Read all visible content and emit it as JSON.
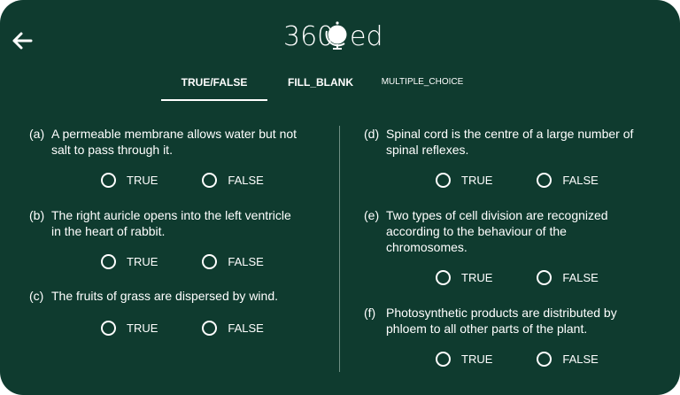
{
  "header": {
    "back_icon": "arrow-left-icon",
    "logo_text_left": "360",
    "logo_text_right": "ed"
  },
  "tabs": [
    {
      "label": "TRUE/FALSE",
      "active": true
    },
    {
      "label": "FILL_BLANK",
      "active": false
    },
    {
      "label": "MULTIPLE_CHOICE",
      "active": false
    }
  ],
  "questions": [
    {
      "letter": "(a)",
      "text_line1": "A permeable membrane allows water but not",
      "text_line2": "salt to pass through it.",
      "text_line3": "",
      "true_label": "TRUE",
      "false_label": "FALSE"
    },
    {
      "letter": "(b)",
      "text_line1": "The right auricle opens into the left ventricle",
      "text_line2": "in the heart of rabbit.",
      "text_line3": "",
      "true_label": "TRUE",
      "false_label": "FALSE"
    },
    {
      "letter": "(c)",
      "text_line1": "The fruits of grass are dispersed by wind.",
      "text_line2": "",
      "text_line3": "",
      "true_label": "TRUE",
      "false_label": "FALSE"
    },
    {
      "letter": "(d)",
      "text_line1": "Spinal cord is the centre of a large number of",
      "text_line2": "spinal reflexes.",
      "text_line3": "",
      "true_label": "TRUE",
      "false_label": "FALSE"
    },
    {
      "letter": "(e)",
      "text_line1": "Two types of cell division are recognized",
      "text_line2": "according to the behaviour of the",
      "text_line3": "chromosomes.",
      "true_label": "TRUE",
      "false_label": "FALSE"
    },
    {
      "letter": "(f)",
      "text_line1": "Photosynthetic products are distributed by",
      "text_line2": "phloem to all other parts of the plant.",
      "text_line3": "",
      "true_label": "TRUE",
      "false_label": "FALSE"
    }
  ],
  "colors": {
    "background": "#0f3b2f",
    "text": "#ffffff"
  }
}
